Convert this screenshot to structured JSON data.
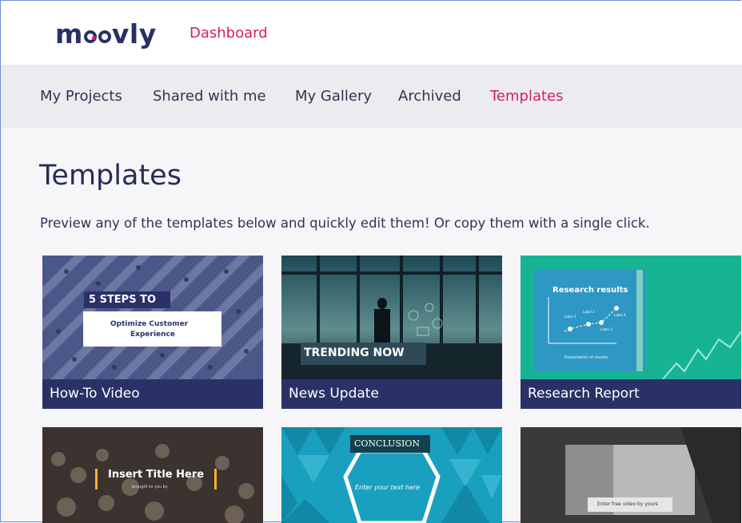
{
  "app": {
    "logo_text": "moovly",
    "dashboard_link": "Dashboard"
  },
  "nav": {
    "items": [
      "My Projects",
      "Shared with me",
      "My Gallery",
      "Archived",
      "Templates"
    ],
    "active": "Templates"
  },
  "page": {
    "title": "Templates",
    "subtitle": "Preview any of the templates below and quickly edit them! Or copy them with a single click."
  },
  "templates": [
    {
      "name": "How-To Video",
      "thumb_text": [
        "5 STEPS TO",
        "Optimize Customer",
        "Experience"
      ]
    },
    {
      "name": "News Update",
      "thumb_text": [
        "TRENDING NOW"
      ]
    },
    {
      "name": "Research Report",
      "thumb_text": [
        "Research results",
        "Explanation of results",
        "Label 1",
        "Label 2",
        "Label 3",
        "Label 4"
      ]
    },
    {
      "name": "",
      "thumb_text": [
        "Insert Title Here",
        "brought to you by"
      ]
    },
    {
      "name": "",
      "thumb_text": [
        "CONCLUSION",
        "Enter your text here"
      ]
    },
    {
      "name": "",
      "thumb_text": [
        "Enter free video by yours"
      ]
    }
  ],
  "colors": {
    "brand": "#2a2f66",
    "accent": "#d81b60",
    "caption_bg": "#2a3166",
    "nav_bg": "#ececf0",
    "page_bg": "#f6f6f9"
  }
}
